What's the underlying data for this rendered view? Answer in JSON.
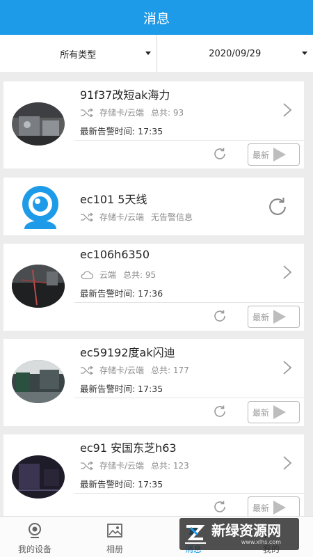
{
  "header": {
    "title": "消息"
  },
  "filters": {
    "type_label": "所有类型",
    "date_label": "2020/09/29"
  },
  "devices": [
    {
      "name": "91f37改短ak海力",
      "storage": "存储卡/云端",
      "total_label": "总共: 93",
      "alarm_time": "最新告警时间: 17:35",
      "latest_label": "最新"
    },
    {
      "name": "ec101 5天线",
      "storage": "存储卡/云端",
      "no_alarm": "无告警信息"
    },
    {
      "name": "ec106h6350",
      "storage": "云端",
      "total_label": "总共: 95",
      "alarm_time": "最新告警时间: 17:36",
      "latest_label": "最新"
    },
    {
      "name": "ec59192度ak闪迪",
      "storage": "存储卡/云端",
      "total_label": "总共: 177",
      "alarm_time": "最新告警时间: 17:35",
      "latest_label": "最新"
    },
    {
      "name": "ec91 安国东芝h63",
      "storage": "存储卡/云端",
      "total_label": "总共: 123",
      "alarm_time": "最新告警时间: 17:35",
      "latest_label": "最新"
    }
  ],
  "tabbar": {
    "devices": "我的设备",
    "album": "相册",
    "messages": "消息",
    "me": "我的"
  },
  "watermark": {
    "text": "新绿资源网",
    "sub": "www.xlhs.com"
  },
  "colors": {
    "primary": "#1e9be8",
    "background": "#ececec",
    "card": "#ffffff"
  }
}
